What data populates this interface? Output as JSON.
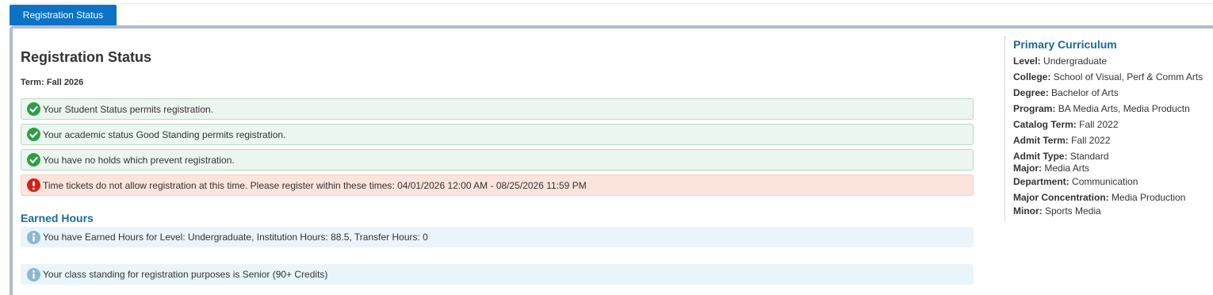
{
  "tab": {
    "label": "Registration Status"
  },
  "page": {
    "title": "Registration Status",
    "term_label": "Term:",
    "term_value": "Fall 2026"
  },
  "messages": {
    "student_status": "Your Student Status permits registration.",
    "academic_status": "Your academic status Good Standing permits registration.",
    "holds": "You have no holds which prevent registration.",
    "time_ticket": "Time tickets do not allow registration at this time. Please register within these times: 04/01/2026 12:00 AM - 08/25/2026 11:59 PM"
  },
  "earned_hours": {
    "title": "Earned Hours",
    "hours_message": "You have Earned Hours for Level: Undergraduate, Institution Hours: 88.5, Transfer Hours: 0",
    "standing_message": "Your class standing for registration purposes is Senior (90+ Credits)"
  },
  "curriculum": {
    "title": "Primary Curriculum",
    "fields": [
      {
        "label": "Level:",
        "value": "Undergraduate"
      },
      {
        "label": "College:",
        "value": "School of Visual, Perf & Comm Arts"
      },
      {
        "label": "Degree:",
        "value": "Bachelor of Arts"
      },
      {
        "label": "Program:",
        "value": "BA Media Arts, Media Productn"
      },
      {
        "label": "Catalog Term:",
        "value": "Fall 2022"
      },
      {
        "label": "Admit Term:",
        "value": "Fall 2022"
      },
      {
        "label": "Admit Type:",
        "value": "Standard"
      },
      {
        "label": "Major:",
        "value": "Media Arts"
      },
      {
        "label": "Department:",
        "value": "Communication"
      },
      {
        "label": "Major Concentration:",
        "value": "Media Production"
      },
      {
        "label": "Minor:",
        "value": "Sports Media"
      }
    ]
  },
  "icons": {
    "success": "check-circle-icon",
    "error": "exclamation-circle-icon",
    "info": "info-circle-icon"
  },
  "colors": {
    "tab": "#0b72c6",
    "success_bg": "#ebf6ee",
    "success_icon": "#2e9e48",
    "error_bg": "#fbe4dc",
    "error_icon": "#d1211b",
    "info_bg": "#e9f5fb",
    "info_icon": "#8fb7cf",
    "heading_blue": "#1d6a96"
  }
}
